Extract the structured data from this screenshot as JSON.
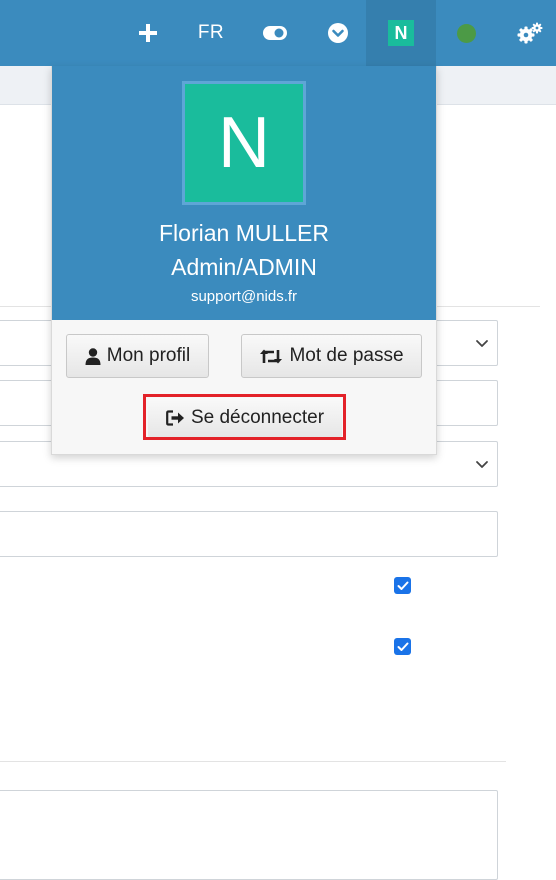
{
  "topbar": {
    "language": "FR",
    "user_badge": "N"
  },
  "user_menu": {
    "avatar_letter": "N",
    "name": "Florian MULLER",
    "role": "Admin/ADMIN",
    "email": "support@nids.fr",
    "profile_button": "Mon profil",
    "password_button": "Mot de passe",
    "logout_button": "Se déconnecter"
  },
  "icons": {
    "add": "plus-icon",
    "toggle": "toggle-icon",
    "dropdown": "chevron-circle-icon",
    "status": "status-dot",
    "settings": "gears-icon",
    "profile": "user-icon",
    "password": "retweet-icon",
    "logout": "sign-out-icon"
  },
  "colors": {
    "topbar": "#3b8bbe",
    "avatar": "#1abc9c",
    "status_online": "#4c9a46",
    "highlight": "#e32229",
    "checkbox": "#1a73e8"
  }
}
